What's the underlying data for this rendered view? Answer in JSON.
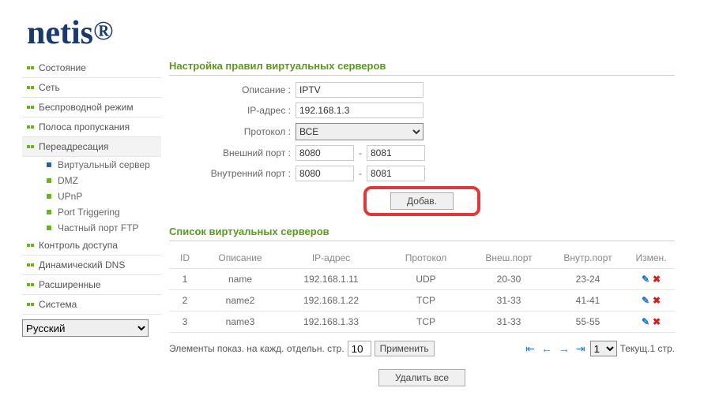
{
  "brand": "netis",
  "nav": {
    "items": [
      {
        "label": "Состояние"
      },
      {
        "label": "Сеть"
      },
      {
        "label": "Беспроводной режим"
      },
      {
        "label": "Полоса пропускания"
      },
      {
        "label": "Переадресация"
      },
      {
        "label": "Контроль доступа"
      },
      {
        "label": "Динамический DNS"
      },
      {
        "label": "Расширенные"
      },
      {
        "label": "Система"
      }
    ],
    "sub_forward": [
      {
        "label": "Виртуальный сервер",
        "active": true
      },
      {
        "label": "DMZ"
      },
      {
        "label": "UPnP"
      },
      {
        "label": "Port Triggering"
      },
      {
        "label": "Частный порт FTP"
      }
    ],
    "language": "Русский"
  },
  "form": {
    "section_title": "Настройка правил виртуальных серверов",
    "labels": {
      "description": "Описание :",
      "ip": "IP-адрес :",
      "protocol": "Протокол :",
      "ext_port": "Внешний порт :",
      "int_port": "Внутренний порт :"
    },
    "values": {
      "description": "IPTV",
      "ip": "192.168.1.3",
      "protocol": "ВСЕ",
      "ext_port_from": "8080",
      "ext_port_to": "8081",
      "int_port_from": "8080",
      "int_port_to": "8081"
    },
    "add_button": "Добав."
  },
  "list": {
    "section_title": "Список виртуальных серверов",
    "headers": {
      "id": "ID",
      "desc": "Описание",
      "ip": "IP-адрес",
      "proto": "Протокол",
      "eport": "Внеш.порт",
      "iport": "Внутр.порт",
      "act": "Измен."
    },
    "rows": [
      {
        "id": "1",
        "desc": "name",
        "ip": "192.168.1.11",
        "proto": "UDP",
        "eport": "20-30",
        "iport": "23-24"
      },
      {
        "id": "2",
        "desc": "name2",
        "ip": "192.168.1.22",
        "proto": "TCP",
        "eport": "31-33",
        "iport": "41-41"
      },
      {
        "id": "3",
        "desc": "name3",
        "ip": "192.168.1.33",
        "proto": "TCP",
        "eport": "31-33",
        "iport": "55-55"
      }
    ],
    "pager": {
      "per_page_label": "Элементы показ. на кажд. отдельн. стр.",
      "per_page_value": "10",
      "apply": "Применить",
      "page_current": "1",
      "page_status": "Текущ.1 стр.",
      "delete_all": "Удалить все"
    }
  }
}
